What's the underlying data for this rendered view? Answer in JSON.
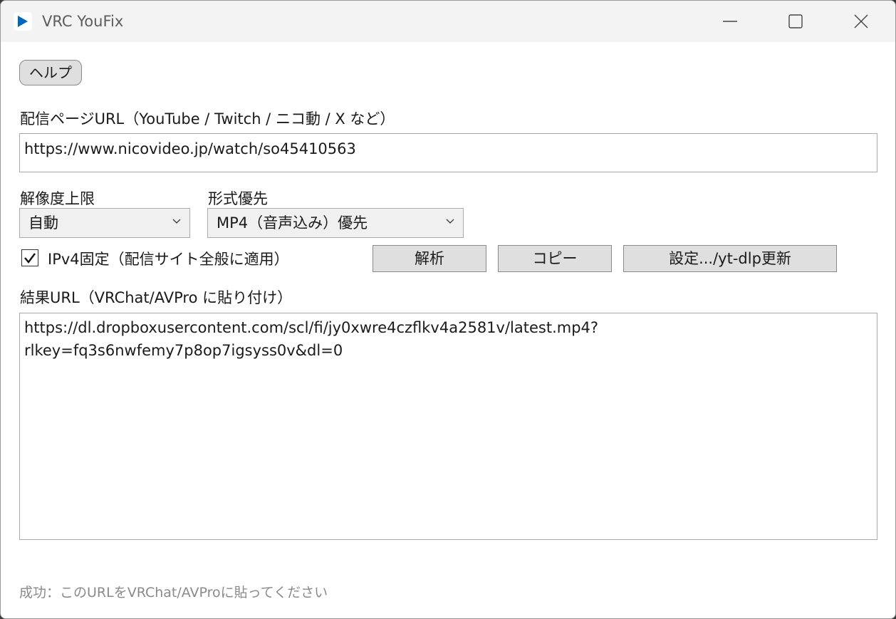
{
  "window": {
    "title": "VRC YouFix",
    "app_icon": "play-icon",
    "controls": [
      "minimize-icon",
      "maximize-icon",
      "close-icon"
    ]
  },
  "help_button": {
    "label": "ヘルプ"
  },
  "url_section": {
    "label": "配信ページURL（YouTube / Twitch / ニコ動 / X など）",
    "value": "https://www.nicovideo.jp/watch/so45410563"
  },
  "resolution": {
    "label": "解像度上限",
    "selected": "自動"
  },
  "format": {
    "label": "形式優先",
    "selected": "MP4（音声込み）優先"
  },
  "ipv4": {
    "label": "IPv4固定（配信サイト全般に適用）",
    "checked": true
  },
  "buttons": {
    "analyze": "解析",
    "copy": "コピー",
    "settings": "設定.../yt-dlp更新"
  },
  "result": {
    "label": "結果URL（VRChat/AVPro に貼り付け）",
    "lines": [
      "https://dl.dropboxusercontent.com/scl/fi/jy0xwre4czflkv4a2581v/latest.mp4?",
      "rlkey=fq3s6nwfemy7p8op7igsyss0v&dl=0"
    ]
  },
  "status": "成功：このURLをVRChat/AVProに貼ってください",
  "colors": {
    "accent": "#0067c0",
    "button_bg": "#dfdfdf",
    "status_text": "#8a8a8a"
  }
}
